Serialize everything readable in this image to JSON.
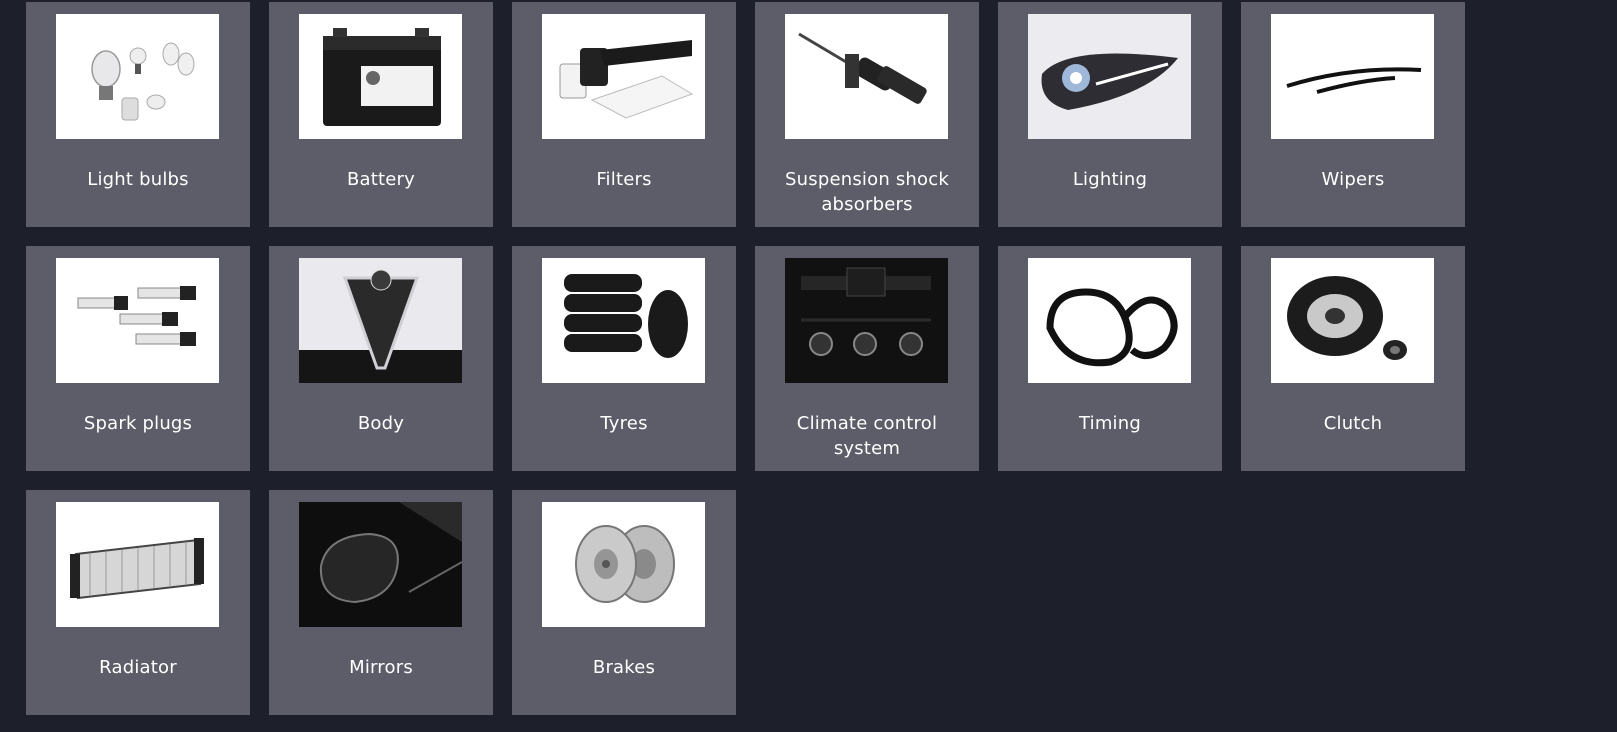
{
  "categories": [
    {
      "label": "Light bulbs",
      "icon": "light-bulbs-icon"
    },
    {
      "label": "Battery",
      "icon": "battery-icon"
    },
    {
      "label": "Filters",
      "icon": "filters-icon"
    },
    {
      "label": "Suspension shock absorbers",
      "icon": "shock-absorber-icon"
    },
    {
      "label": "Lighting",
      "icon": "headlight-icon"
    },
    {
      "label": "Wipers",
      "icon": "wipers-icon"
    },
    {
      "label": "Spark plugs",
      "icon": "spark-plugs-icon"
    },
    {
      "label": "Body",
      "icon": "car-body-icon"
    },
    {
      "label": "Tyres",
      "icon": "tyres-icon"
    },
    {
      "label": "Climate control system",
      "icon": "climate-control-icon"
    },
    {
      "label": "Timing",
      "icon": "timing-belt-icon"
    },
    {
      "label": "Clutch",
      "icon": "clutch-icon"
    },
    {
      "label": "Radiator",
      "icon": "radiator-icon"
    },
    {
      "label": "Mirrors",
      "icon": "mirror-icon"
    },
    {
      "label": "Brakes",
      "icon": "brake-discs-icon"
    }
  ]
}
